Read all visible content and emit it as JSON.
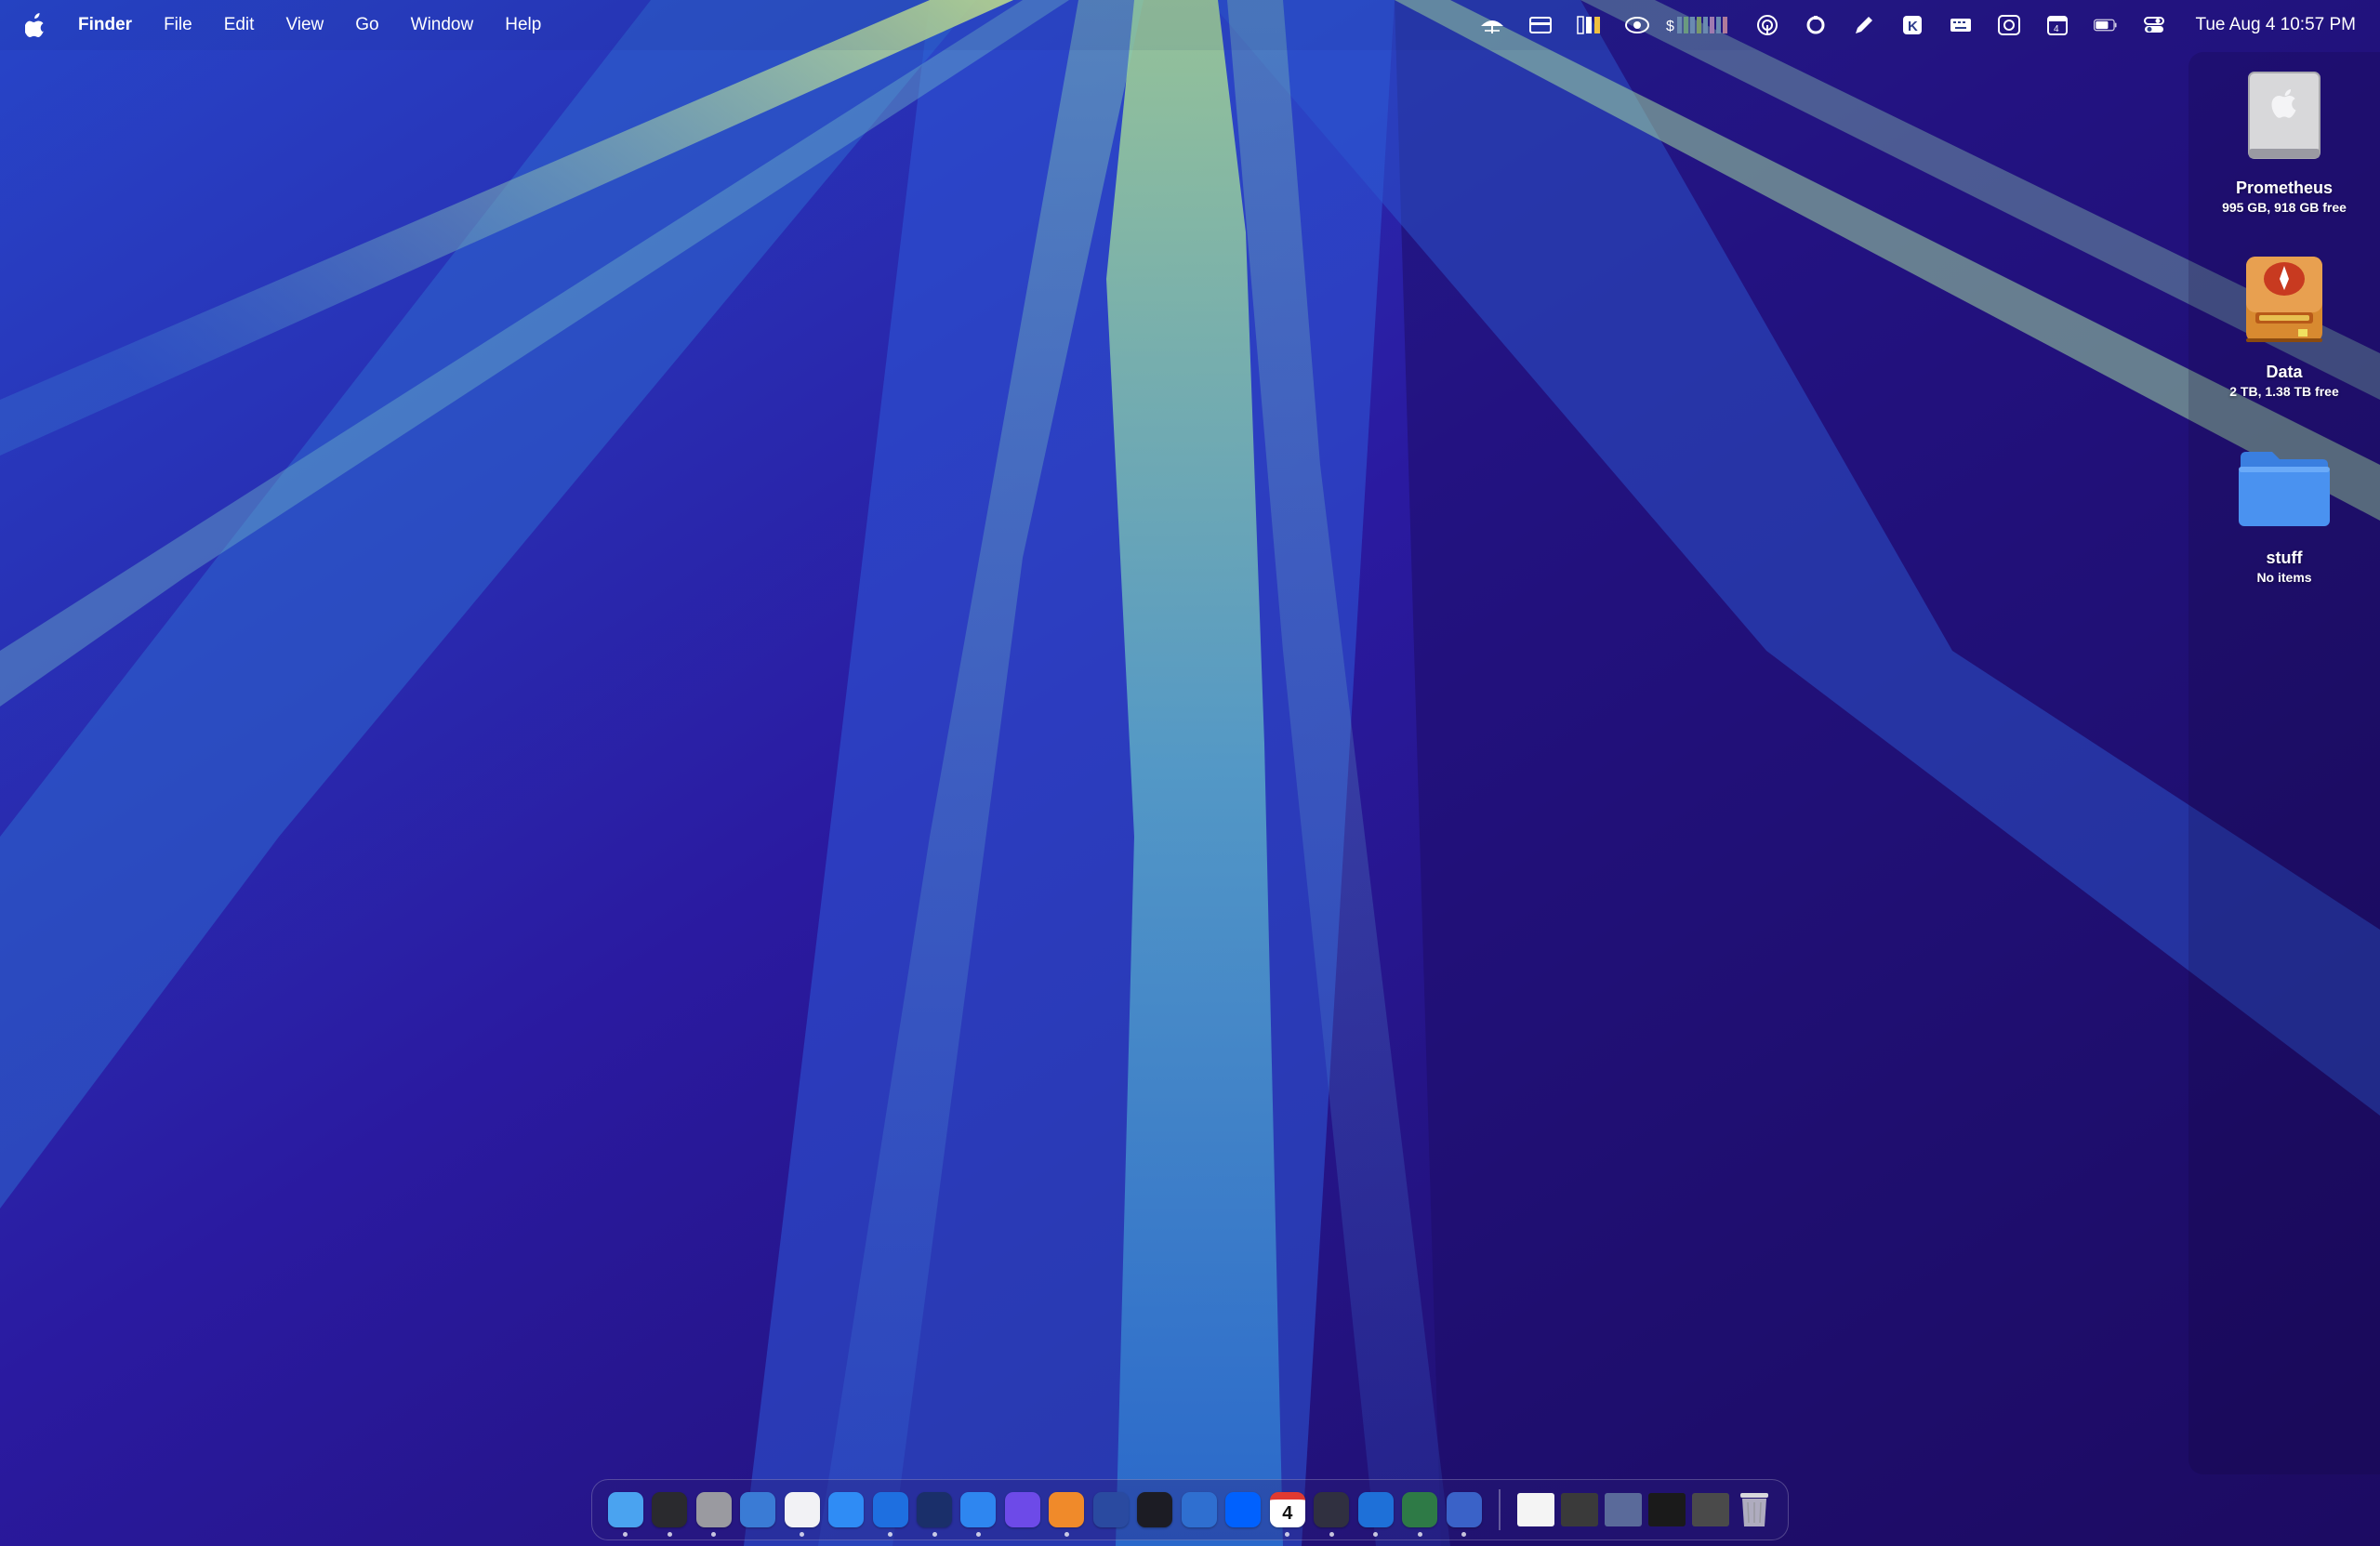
{
  "menubar": {
    "apple_icon": "apple-logo-icon",
    "app_name": "Finder",
    "menus": [
      "File",
      "Edit",
      "View",
      "Go",
      "Window",
      "Help"
    ],
    "status_icons": [
      "umbrella-icon",
      "card-icon",
      "battery-levels-icon",
      "eye-icon",
      "cpu-history-icon",
      "fingerprint-icon",
      "sync-circle-icon",
      "pen-icon",
      "k-badge-icon",
      "keyboard-icon",
      "screen-capture-icon",
      "calendar-date-icon",
      "battery-icon",
      "control-center-icon"
    ],
    "clock": "Tue Aug 4  10:57 PM"
  },
  "desktop": {
    "items": [
      {
        "name": "Prometheus",
        "sub": "995 GB, 918 GB free",
        "icon": "internal-drive-icon"
      },
      {
        "name": "Data",
        "sub": "2 TB, 1.38 TB free",
        "icon": "external-drive-icon"
      },
      {
        "name": "stuff",
        "sub": "No items",
        "icon": "folder-icon"
      }
    ]
  },
  "dock": {
    "apps": [
      {
        "name": "finder-icon",
        "color": "#4aa3f0",
        "running": true
      },
      {
        "name": "activity-monitor-icon",
        "color": "#2a2a2e",
        "running": true
      },
      {
        "name": "system-settings-icon",
        "color": "#9a9aa0",
        "running": true
      },
      {
        "name": "safari-icon",
        "color": "#3a7bd5",
        "running": false
      },
      {
        "name": "reminders-icon",
        "color": "#f2f2f5",
        "running": true
      },
      {
        "name": "files-icon",
        "color": "#2f8cf5",
        "running": false
      },
      {
        "name": "compass-icon",
        "color": "#1e6fe0",
        "running": true
      },
      {
        "name": "asterisk-app-icon",
        "color": "#1a2f6a",
        "running": true
      },
      {
        "name": "mail-icon",
        "color": "#2e86f0",
        "running": true
      },
      {
        "name": "proton-icon",
        "color": "#6d4ae8",
        "running": false
      },
      {
        "name": "rocket-icon",
        "color": "#f08a2a",
        "running": true
      },
      {
        "name": "screen-icon",
        "color": "#2a4aa0",
        "running": false
      },
      {
        "name": "screenshot-icon",
        "color": "#1c1c24",
        "running": false
      },
      {
        "name": "phone-icon",
        "color": "#2f6fd0",
        "running": false
      },
      {
        "name": "dropbox-icon",
        "color": "#0061fe",
        "running": false
      },
      {
        "name": "calendar-icon",
        "color": "#ffffff",
        "running": true,
        "label": "4"
      },
      {
        "name": "circle-app-icon",
        "color": "#303040",
        "running": true
      },
      {
        "name": "xcode-icon",
        "color": "#1e70d8",
        "running": true
      },
      {
        "name": "numbers-icon",
        "color": "#2e7a46",
        "running": true
      },
      {
        "name": "cloud-icon",
        "color": "#3a62c8",
        "running": true
      }
    ],
    "docs": [
      {
        "name": "document-thumbnail-1",
        "color": "#f4f4f4"
      },
      {
        "name": "document-thumbnail-2",
        "color": "#3a3a3a"
      },
      {
        "name": "document-thumbnail-3",
        "color": "#5a6a9a"
      },
      {
        "name": "document-thumbnail-4",
        "color": "#1a1a1a"
      },
      {
        "name": "document-thumbnail-5",
        "color": "#4a4a4a"
      }
    ],
    "trash_icon": "trash-icon"
  }
}
